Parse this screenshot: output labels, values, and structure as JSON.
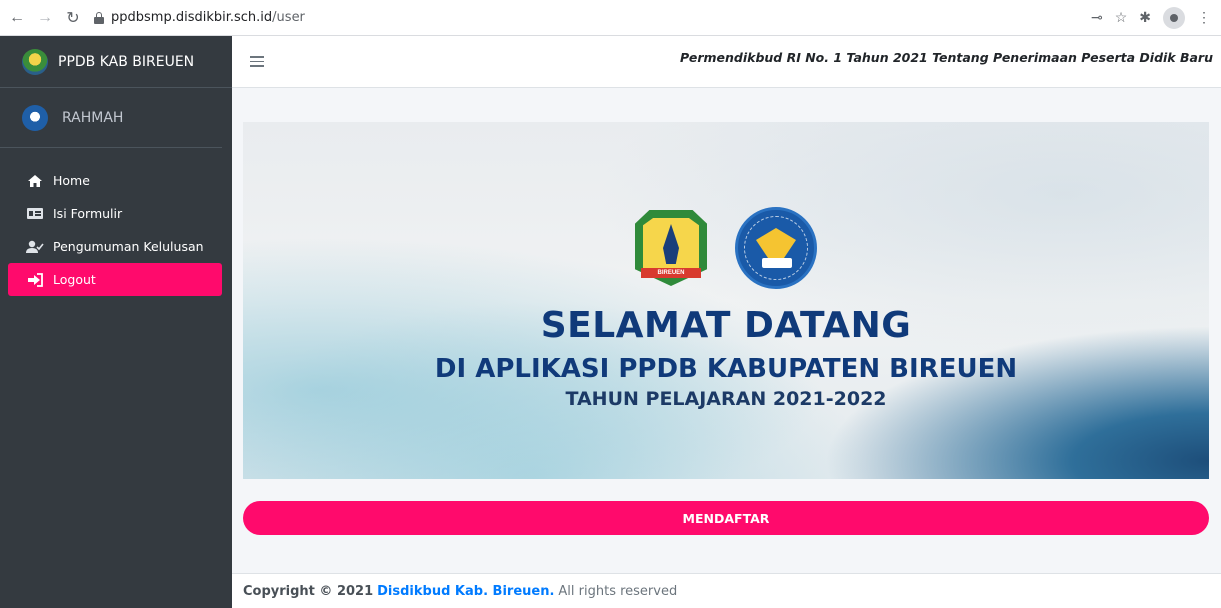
{
  "browser": {
    "url_host": "ppdbsmp.disdikbir.sch.id",
    "url_path": "/user"
  },
  "sidebar": {
    "brand": "PPDB KAB BIREUEN",
    "user": "RAHMAH",
    "items": [
      {
        "label": "Home",
        "icon": "home-icon"
      },
      {
        "label": "Isi Formulir",
        "icon": "form-icon"
      },
      {
        "label": "Pengumuman Kelulusan",
        "icon": "user-check-icon"
      },
      {
        "label": "Logout",
        "icon": "sign-out-icon",
        "active": true
      }
    ]
  },
  "header": {
    "notice": "Permendikbud RI No. 1 Tahun 2021 Tentang Penerimaan Peserta Didik Baru"
  },
  "banner": {
    "title": "SELAMAT DATANG",
    "subtitle": "DI APLIKASI PPDB KABUPATEN BIREUEN",
    "year": "TAHUN PELAJARAN 2021-2022",
    "logo_ribbon": "BIREUEN"
  },
  "register_button": "MENDAFTAR",
  "footer": {
    "prefix": "Copyright © 2021",
    "link": "Disdikbud Kab. Bireuen.",
    "suffix": "All rights reserved"
  },
  "colors": {
    "accent": "#ff0a6c",
    "sidebar": "#343a40",
    "title": "#103a7a"
  }
}
